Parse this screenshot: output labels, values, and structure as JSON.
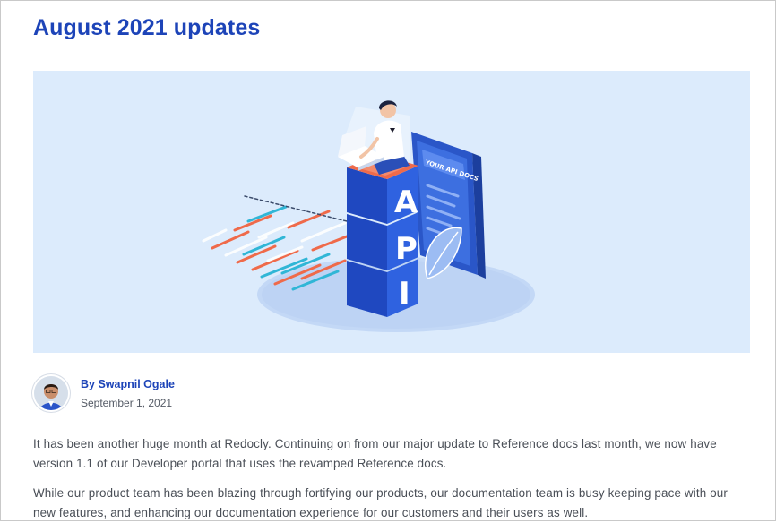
{
  "post": {
    "title": "August 2021 updates",
    "hero_image": {
      "text_block_letters": [
        "A",
        "P",
        "I"
      ],
      "phone_screen_label": "YOUR API DOCS"
    },
    "author": {
      "by_prefix": "By",
      "name": "Swapnil Ogale",
      "date": "September 1, 2021"
    },
    "paragraphs": [
      "It has been another huge month at Redocly. Continuing on from our major update to Reference docs last month, we now have version 1.1 of our Developer portal that uses the revamped Reference docs.",
      "While our product team has been blazing through fortifying our products, our documentation team is busy keeping pace with our new features, and enhancing our documentation experience for our customers and their users as well."
    ]
  },
  "colors": {
    "title": "#1d44b8",
    "link": "#1d44b8",
    "hero_bg": "#dcebfc",
    "body_text": "#4a4f57"
  }
}
